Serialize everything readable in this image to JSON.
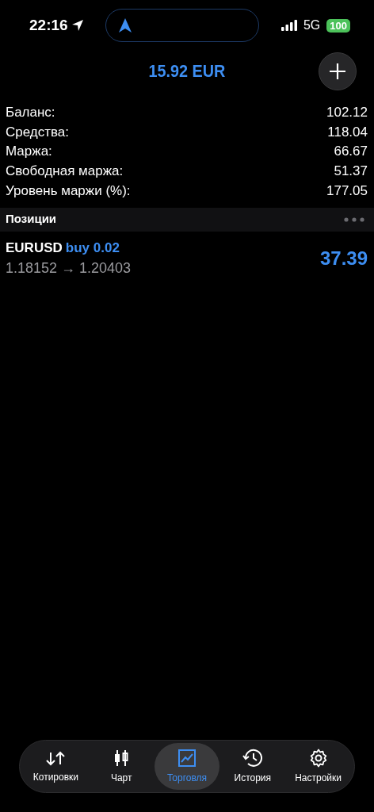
{
  "status_bar": {
    "time": "22:16",
    "network": "5G",
    "battery": "100"
  },
  "header": {
    "balance": "15.92 EUR"
  },
  "summary": [
    {
      "label": "Баланс:",
      "value": "102.12"
    },
    {
      "label": "Средства:",
      "value": "118.04"
    },
    {
      "label": "Маржа:",
      "value": "66.67"
    },
    {
      "label": "Свободная маржа:",
      "value": "51.37"
    },
    {
      "label": "Уровень маржи (%):",
      "value": "177.05"
    }
  ],
  "positions": {
    "title": "Позиции",
    "items": [
      {
        "symbol": "EURUSD",
        "side": "buy 0.02",
        "prices": "1.18152 → 1.20403",
        "profit": "37.39"
      }
    ]
  },
  "tab_bar": [
    {
      "kind": "quotes",
      "label": "Котировки",
      "selected": false
    },
    {
      "kind": "chart",
      "label": "Чарт",
      "selected": false
    },
    {
      "kind": "trade",
      "label": "Торговля",
      "selected": true
    },
    {
      "kind": "history",
      "label": "История",
      "selected": false
    },
    {
      "kind": "settings",
      "label": "Настройки",
      "selected": false
    }
  ]
}
